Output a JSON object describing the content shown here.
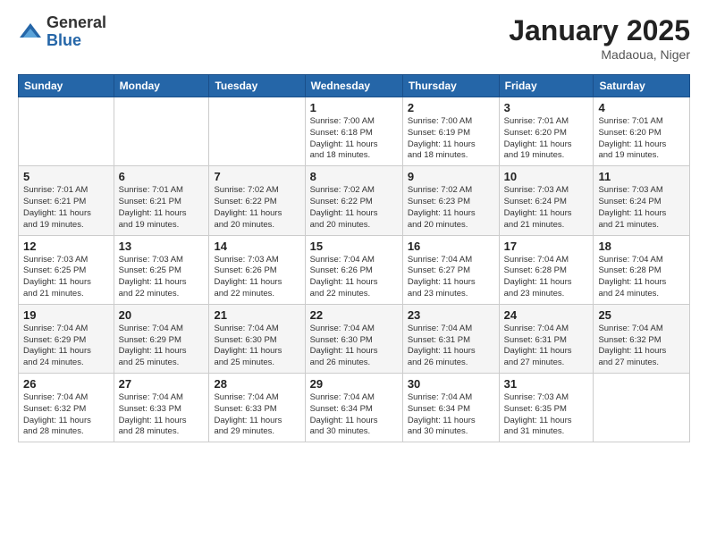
{
  "logo": {
    "general": "General",
    "blue": "Blue"
  },
  "title": "January 2025",
  "subtitle": "Madaoua, Niger",
  "weekdays": [
    "Sunday",
    "Monday",
    "Tuesday",
    "Wednesday",
    "Thursday",
    "Friday",
    "Saturday"
  ],
  "weeks": [
    [
      {
        "day": "",
        "info": ""
      },
      {
        "day": "",
        "info": ""
      },
      {
        "day": "",
        "info": ""
      },
      {
        "day": "1",
        "info": "Sunrise: 7:00 AM\nSunset: 6:18 PM\nDaylight: 11 hours\nand 18 minutes."
      },
      {
        "day": "2",
        "info": "Sunrise: 7:00 AM\nSunset: 6:19 PM\nDaylight: 11 hours\nand 18 minutes."
      },
      {
        "day": "3",
        "info": "Sunrise: 7:01 AM\nSunset: 6:20 PM\nDaylight: 11 hours\nand 19 minutes."
      },
      {
        "day": "4",
        "info": "Sunrise: 7:01 AM\nSunset: 6:20 PM\nDaylight: 11 hours\nand 19 minutes."
      }
    ],
    [
      {
        "day": "5",
        "info": "Sunrise: 7:01 AM\nSunset: 6:21 PM\nDaylight: 11 hours\nand 19 minutes."
      },
      {
        "day": "6",
        "info": "Sunrise: 7:01 AM\nSunset: 6:21 PM\nDaylight: 11 hours\nand 19 minutes."
      },
      {
        "day": "7",
        "info": "Sunrise: 7:02 AM\nSunset: 6:22 PM\nDaylight: 11 hours\nand 20 minutes."
      },
      {
        "day": "8",
        "info": "Sunrise: 7:02 AM\nSunset: 6:22 PM\nDaylight: 11 hours\nand 20 minutes."
      },
      {
        "day": "9",
        "info": "Sunrise: 7:02 AM\nSunset: 6:23 PM\nDaylight: 11 hours\nand 20 minutes."
      },
      {
        "day": "10",
        "info": "Sunrise: 7:03 AM\nSunset: 6:24 PM\nDaylight: 11 hours\nand 21 minutes."
      },
      {
        "day": "11",
        "info": "Sunrise: 7:03 AM\nSunset: 6:24 PM\nDaylight: 11 hours\nand 21 minutes."
      }
    ],
    [
      {
        "day": "12",
        "info": "Sunrise: 7:03 AM\nSunset: 6:25 PM\nDaylight: 11 hours\nand 21 minutes."
      },
      {
        "day": "13",
        "info": "Sunrise: 7:03 AM\nSunset: 6:25 PM\nDaylight: 11 hours\nand 22 minutes."
      },
      {
        "day": "14",
        "info": "Sunrise: 7:03 AM\nSunset: 6:26 PM\nDaylight: 11 hours\nand 22 minutes."
      },
      {
        "day": "15",
        "info": "Sunrise: 7:04 AM\nSunset: 6:26 PM\nDaylight: 11 hours\nand 22 minutes."
      },
      {
        "day": "16",
        "info": "Sunrise: 7:04 AM\nSunset: 6:27 PM\nDaylight: 11 hours\nand 23 minutes."
      },
      {
        "day": "17",
        "info": "Sunrise: 7:04 AM\nSunset: 6:28 PM\nDaylight: 11 hours\nand 23 minutes."
      },
      {
        "day": "18",
        "info": "Sunrise: 7:04 AM\nSunset: 6:28 PM\nDaylight: 11 hours\nand 24 minutes."
      }
    ],
    [
      {
        "day": "19",
        "info": "Sunrise: 7:04 AM\nSunset: 6:29 PM\nDaylight: 11 hours\nand 24 minutes."
      },
      {
        "day": "20",
        "info": "Sunrise: 7:04 AM\nSunset: 6:29 PM\nDaylight: 11 hours\nand 25 minutes."
      },
      {
        "day": "21",
        "info": "Sunrise: 7:04 AM\nSunset: 6:30 PM\nDaylight: 11 hours\nand 25 minutes."
      },
      {
        "day": "22",
        "info": "Sunrise: 7:04 AM\nSunset: 6:30 PM\nDaylight: 11 hours\nand 26 minutes."
      },
      {
        "day": "23",
        "info": "Sunrise: 7:04 AM\nSunset: 6:31 PM\nDaylight: 11 hours\nand 26 minutes."
      },
      {
        "day": "24",
        "info": "Sunrise: 7:04 AM\nSunset: 6:31 PM\nDaylight: 11 hours\nand 27 minutes."
      },
      {
        "day": "25",
        "info": "Sunrise: 7:04 AM\nSunset: 6:32 PM\nDaylight: 11 hours\nand 27 minutes."
      }
    ],
    [
      {
        "day": "26",
        "info": "Sunrise: 7:04 AM\nSunset: 6:32 PM\nDaylight: 11 hours\nand 28 minutes."
      },
      {
        "day": "27",
        "info": "Sunrise: 7:04 AM\nSunset: 6:33 PM\nDaylight: 11 hours\nand 28 minutes."
      },
      {
        "day": "28",
        "info": "Sunrise: 7:04 AM\nSunset: 6:33 PM\nDaylight: 11 hours\nand 29 minutes."
      },
      {
        "day": "29",
        "info": "Sunrise: 7:04 AM\nSunset: 6:34 PM\nDaylight: 11 hours\nand 30 minutes."
      },
      {
        "day": "30",
        "info": "Sunrise: 7:04 AM\nSunset: 6:34 PM\nDaylight: 11 hours\nand 30 minutes."
      },
      {
        "day": "31",
        "info": "Sunrise: 7:03 AM\nSunset: 6:35 PM\nDaylight: 11 hours\nand 31 minutes."
      },
      {
        "day": "",
        "info": ""
      }
    ]
  ]
}
